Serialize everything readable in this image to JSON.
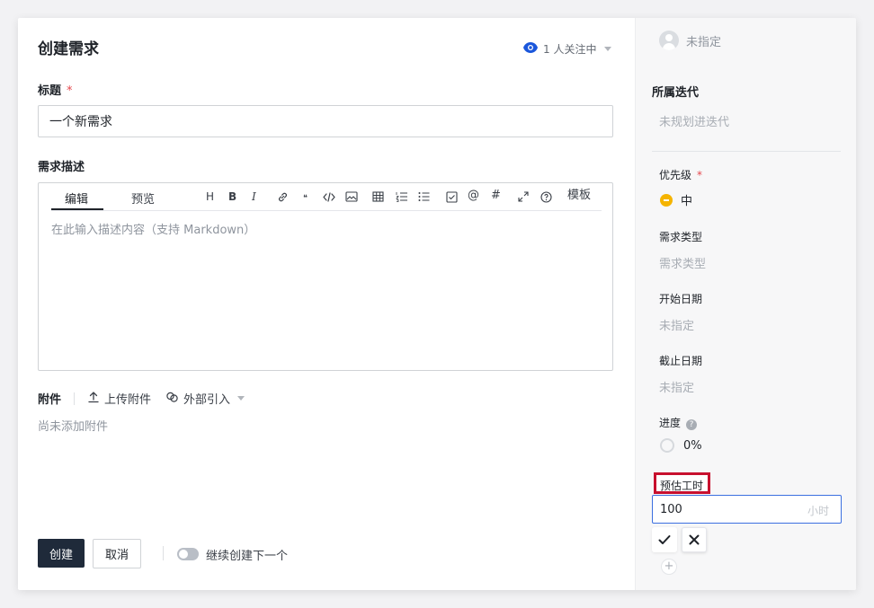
{
  "dialog": {
    "title": "创建需求",
    "watchers": "1 人关注中"
  },
  "form": {
    "title_label": "标题",
    "required_mark": "*",
    "title_value": "一个新需求",
    "desc_label": "需求描述",
    "editor": {
      "tab_edit": "编辑",
      "tab_preview": "预览",
      "tool_h": "H",
      "tool_b": "B",
      "tool_i": "I",
      "tool_quote": "❝",
      "tool_at": "@",
      "tool_hash": "#",
      "tool_template": "模板",
      "placeholder": "在此输入描述内容（支持 Markdown）"
    },
    "attachments_label": "附件",
    "upload_label": "上传附件",
    "external_label": "外部引入",
    "no_attachments": "尚未添加附件"
  },
  "footer": {
    "create_label": "创建",
    "cancel_label": "取消",
    "continue_label": "继续创建下一个"
  },
  "sidebar": {
    "assignee": "未指定",
    "iteration_label": "所属迭代",
    "iteration_value": "未规划进迭代",
    "priority_label": "优先级",
    "priority_value": "中",
    "type_label": "需求类型",
    "type_value": "需求类型",
    "start_label": "开始日期",
    "start_value": "未指定",
    "due_label": "截止日期",
    "due_value": "未指定",
    "progress_label": "进度",
    "progress_help": "?",
    "progress_value": "0%",
    "estimate_label": "预估工时",
    "estimate_value": "100",
    "estimate_unit": "小时",
    "plus": "+"
  },
  "colors": {
    "primary_button": "#1f2a3a",
    "priority_medium": "#f5b400",
    "watch_eye": "#1a56db",
    "focus_border": "#3b6fe0",
    "highlight_box": "#c8102e"
  }
}
